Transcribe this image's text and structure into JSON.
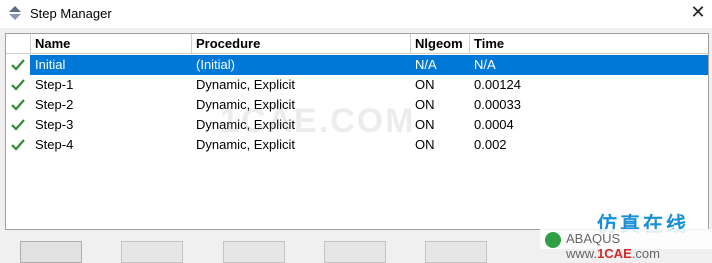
{
  "window": {
    "title": "Step Manager",
    "close_glyph": "✕"
  },
  "table": {
    "headers": {
      "name": "Name",
      "procedure": "Procedure",
      "nlgeom": "Nlgeom",
      "time": "Time"
    },
    "rows": [
      {
        "name": "Initial",
        "procedure": "(Initial)",
        "nlgeom": "N/A",
        "time": "N/A",
        "selected": true
      },
      {
        "name": "Step-1",
        "procedure": "Dynamic, Explicit",
        "nlgeom": "ON",
        "time": "0.00124"
      },
      {
        "name": "Step-2",
        "procedure": "Dynamic, Explicit",
        "nlgeom": "ON",
        "time": "0.00033"
      },
      {
        "name": "Step-3",
        "procedure": "Dynamic, Explicit",
        "nlgeom": "ON",
        "time": "0.0004"
      },
      {
        "name": "Step-4",
        "procedure": "Dynamic, Explicit",
        "nlgeom": "ON",
        "time": "0.002"
      }
    ]
  },
  "watermark": {
    "text": "1CAE.COM"
  },
  "brand": {
    "text": "仿真在线"
  },
  "logo": {
    "text_prefix": "ABAQUS",
    "site_prefix": "www.",
    "site_highlight": "1CAE",
    "site_suffix": ".com"
  },
  "colors": {
    "selection": "#0078d7",
    "check": "#2e8b2e"
  }
}
